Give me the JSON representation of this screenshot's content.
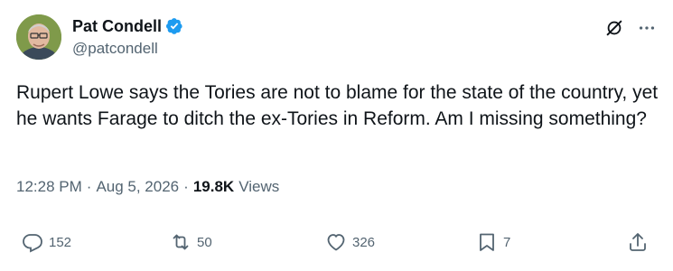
{
  "author": {
    "display_name": "Pat Condell",
    "handle": "@patcondell",
    "verified": true
  },
  "tweet": {
    "text": "Rupert Lowe says the Tories are not to blame for the state of the country, yet he wants Farage to ditch the ex-Tories in Reform. Am I missing something?"
  },
  "meta": {
    "time": "12:28 PM",
    "separator": "·",
    "date": "Aug 5, 2026",
    "views_count": "19.8K",
    "views_label": "Views"
  },
  "actions": {
    "replies": "152",
    "reposts": "50",
    "likes": "326",
    "bookmarks": "7"
  },
  "icons": {
    "verified": "verified-badge-icon",
    "grok": "grok-icon",
    "more": "more-icon",
    "reply": "reply-icon",
    "repost": "repost-icon",
    "like": "heart-icon",
    "bookmark": "bookmark-icon",
    "share": "share-icon"
  },
  "colors": {
    "text": "#0f1419",
    "secondary": "#536471",
    "verified": "#1d9bf0"
  }
}
